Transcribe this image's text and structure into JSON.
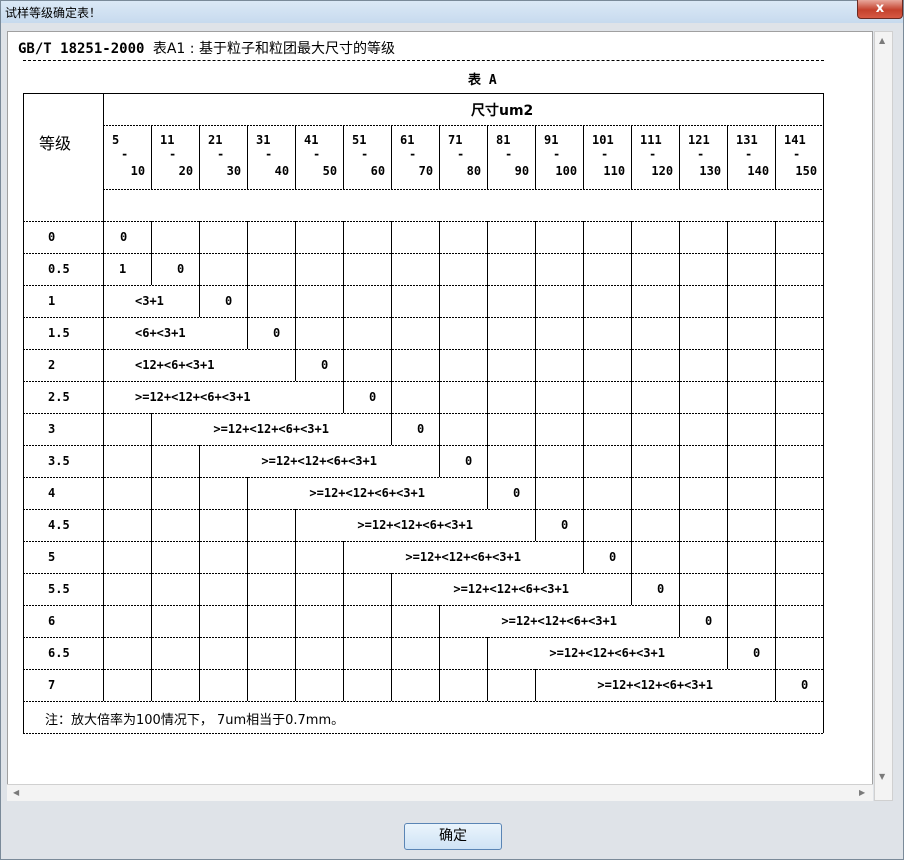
{
  "window": {
    "title": "试样等级确定表！",
    "close_label": "x"
  },
  "doc": {
    "title_code": "GB/T 18251-2000 ",
    "title_rest": "表A1 : 基于粒子和粒团最大尺寸的等级",
    "table_caption": "表 A"
  },
  "table": {
    "grade_header": "等级",
    "size_header": "尺寸um2",
    "size_ranges": [
      {
        "lo": "5",
        "hi": "10"
      },
      {
        "lo": "11",
        "hi": "20"
      },
      {
        "lo": "21",
        "hi": "30"
      },
      {
        "lo": "31",
        "hi": "40"
      },
      {
        "lo": "41",
        "hi": "50"
      },
      {
        "lo": "51",
        "hi": "60"
      },
      {
        "lo": "61",
        "hi": "70"
      },
      {
        "lo": "71",
        "hi": "80"
      },
      {
        "lo": "81",
        "hi": "90"
      },
      {
        "lo": "91",
        "hi": "100"
      },
      {
        "lo": "101",
        "hi": "110"
      },
      {
        "lo": "111",
        "hi": "120"
      },
      {
        "lo": "121",
        "hi": "130"
      },
      {
        "lo": "131",
        "hi": "140"
      },
      {
        "lo": "141",
        "hi": "150"
      }
    ],
    "range_dash": "-",
    "rows": [
      {
        "grade": "0",
        "span_text": "",
        "zero": "0"
      },
      {
        "grade": "0.5",
        "span_text": "1",
        "zero": "0"
      },
      {
        "grade": "1",
        "span_text": "<3+1",
        "zero": "0"
      },
      {
        "grade": "1.5",
        "span_text": "<6+<3+1",
        "zero": "0"
      },
      {
        "grade": "2",
        "span_text": "<12+<6+<3+1",
        "zero": "0"
      },
      {
        "grade": "2.5",
        "span_text": ">=12+<12+<6+<3+1",
        "zero": "0"
      },
      {
        "grade": "3",
        "span_text": ">=12+<12+<6+<3+1",
        "zero": "0"
      },
      {
        "grade": "3.5",
        "span_text": ">=12+<12+<6+<3+1",
        "zero": "0"
      },
      {
        "grade": "4",
        "span_text": ">=12+<12+<6+<3+1",
        "zero": "0"
      },
      {
        "grade": "4.5",
        "span_text": ">=12+<12+<6+<3+1",
        "zero": "0"
      },
      {
        "grade": "5",
        "span_text": ">=12+<12+<6+<3+1",
        "zero": "0"
      },
      {
        "grade": "5.5",
        "span_text": ">=12+<12+<6+<3+1",
        "zero": "0"
      },
      {
        "grade": "6",
        "span_text": ">=12+<12+<6+<3+1",
        "zero": "0"
      },
      {
        "grade": "6.5",
        "span_text": ">=12+<12+<6+<3+1",
        "zero": "0"
      },
      {
        "grade": "7",
        "span_text": ">=12+<12+<6+<3+1",
        "zero": "0"
      }
    ],
    "note": "注：放大倍率为100情况下， 7um相当于0.7mm。"
  },
  "buttons": {
    "ok_label": "确定"
  }
}
